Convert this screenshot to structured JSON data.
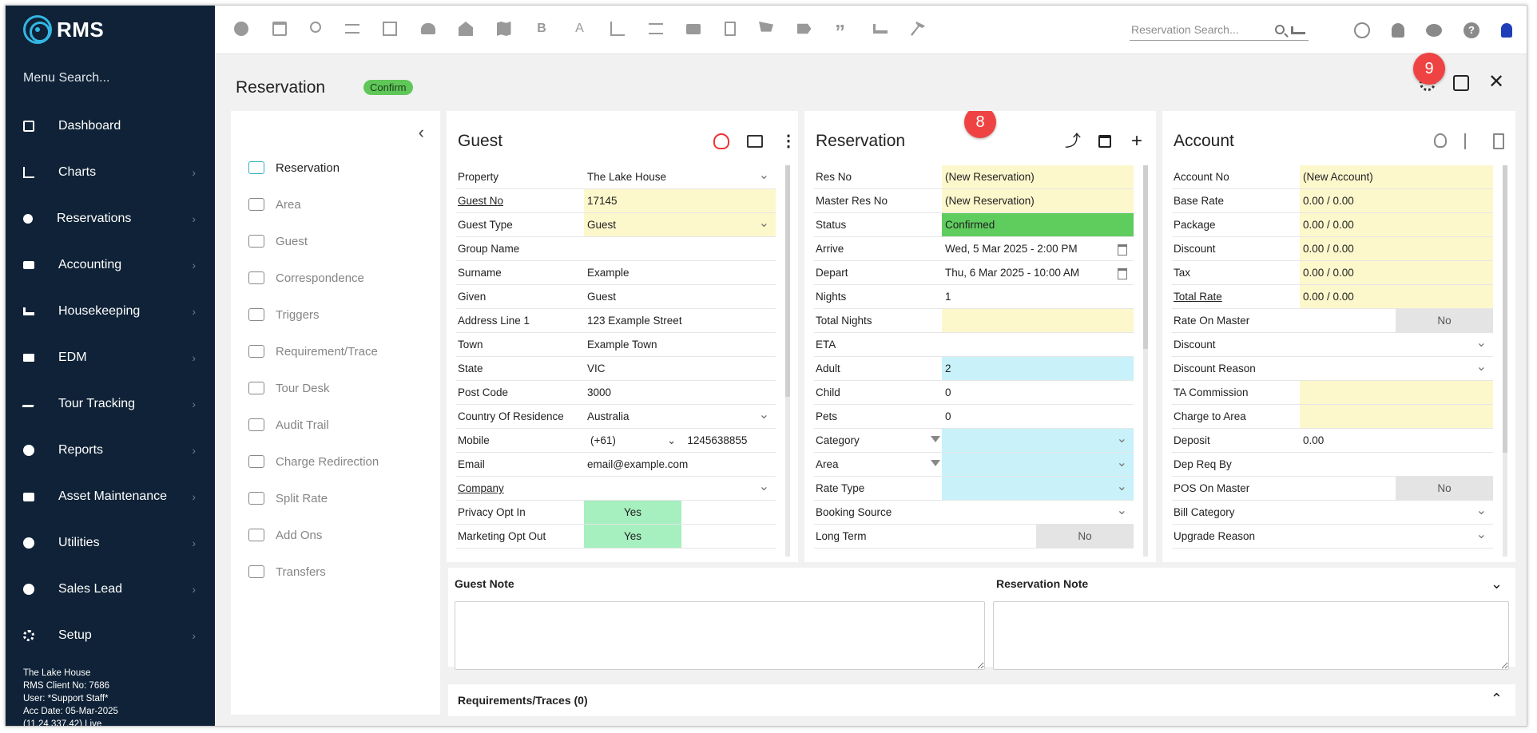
{
  "app": {
    "logo": "RMS"
  },
  "sidebar": {
    "menu_search": "Menu Search...",
    "items": [
      {
        "label": "Dashboard",
        "icon": "dashboard-icon",
        "chevron": false
      },
      {
        "label": "Charts",
        "icon": "charts-icon",
        "chevron": true
      },
      {
        "label": "Reservations",
        "icon": "reservations-icon",
        "chevron": true
      },
      {
        "label": "Accounting",
        "icon": "accounting-icon",
        "chevron": true
      },
      {
        "label": "Housekeeping",
        "icon": "housekeeping-icon",
        "chevron": true
      },
      {
        "label": "EDM",
        "icon": "edm-icon",
        "chevron": true
      },
      {
        "label": "Tour Tracking",
        "icon": "tour-tracking-icon",
        "chevron": true
      },
      {
        "label": "Reports",
        "icon": "reports-icon",
        "chevron": true
      },
      {
        "label": "Asset Maintenance",
        "icon": "asset-maintenance-icon",
        "chevron": true
      },
      {
        "label": "Utilities",
        "icon": "utilities-icon",
        "chevron": true
      },
      {
        "label": "Sales Lead",
        "icon": "sales-lead-icon",
        "chevron": true
      },
      {
        "label": "Setup",
        "icon": "setup-icon",
        "chevron": true
      }
    ],
    "footer": {
      "property": "The Lake House",
      "client": "RMS Client No: 7686",
      "user": "User: *Support Staff*",
      "acc_date": "Acc Date: 05-Mar-2025",
      "version": "(11.24.337.42) Live"
    }
  },
  "topbar": {
    "icons": [
      "add-icon",
      "calendar-icon",
      "search-icon",
      "sliders-icon",
      "grid-icon",
      "guests-icon",
      "map-pin-icon",
      "map-icon",
      "bold-b-icon",
      "letter-a-icon",
      "chart-line-icon",
      "checklist-icon",
      "id-card-icon",
      "document-icon",
      "cart-icon",
      "tag-icon",
      "quote-icon",
      "bed-icon",
      "hammer-icon"
    ],
    "search_placeholder": "Reservation Search...",
    "right_icons": [
      "globe-icon",
      "bell-icon",
      "chat-icon",
      "help-icon",
      "user-icon"
    ]
  },
  "page": {
    "title": "Reservation",
    "badge": "Confirm",
    "callout_8": "8",
    "callout_9": "9"
  },
  "left_nav": {
    "items": [
      {
        "label": "Reservation",
        "active": true
      },
      {
        "label": "Area"
      },
      {
        "label": "Guest"
      },
      {
        "label": "Correspondence"
      },
      {
        "label": "Triggers"
      },
      {
        "label": "Requirement/Trace"
      },
      {
        "label": "Tour Desk"
      },
      {
        "label": "Audit Trail"
      },
      {
        "label": "Charge Redirection"
      },
      {
        "label": "Split Rate"
      },
      {
        "label": "Add Ons"
      },
      {
        "label": "Transfers"
      }
    ]
  },
  "guest": {
    "title": "Guest",
    "rows": [
      {
        "label": "Property",
        "value": "The Lake House"
      },
      {
        "label": "Guest No",
        "value": "17145"
      },
      {
        "label": "Guest Type",
        "value": "Guest"
      },
      {
        "label": "Group Name",
        "value": ""
      },
      {
        "label": "Surname",
        "value": "Example"
      },
      {
        "label": "Given",
        "value": "Guest"
      },
      {
        "label": "Address Line 1",
        "value": "123 Example Street"
      },
      {
        "label": "Town",
        "value": "Example Town"
      },
      {
        "label": "State",
        "value": "VIC"
      },
      {
        "label": "Post Code",
        "value": "3000"
      },
      {
        "label": "Country Of Residence",
        "value": "Australia"
      },
      {
        "label": "Mobile",
        "value": "1245638855",
        "prefix": "(+61)"
      },
      {
        "label": "Email",
        "value": "email@example.com"
      },
      {
        "label": "Company",
        "value": ""
      },
      {
        "label": "Privacy Opt In",
        "value": "Yes"
      },
      {
        "label": "Marketing Opt Out",
        "value": "Yes"
      }
    ]
  },
  "reservation": {
    "title": "Reservation",
    "rows": [
      {
        "label": "Res No",
        "value": "(New Reservation)"
      },
      {
        "label": "Master Res No",
        "value": "(New Reservation)"
      },
      {
        "label": "Status",
        "value": "Confirmed"
      },
      {
        "label": "Arrive",
        "value": "Wed, 5 Mar 2025 - 2:00 PM"
      },
      {
        "label": "Depart",
        "value": "Thu, 6 Mar 2025 - 10:00 AM"
      },
      {
        "label": "Nights",
        "value": "1"
      },
      {
        "label": "Total Nights",
        "value": ""
      },
      {
        "label": "ETA",
        "value": ""
      },
      {
        "label": "Adult",
        "value": "2"
      },
      {
        "label": "Child",
        "value": "0"
      },
      {
        "label": "Pets",
        "value": "0"
      },
      {
        "label": "Category",
        "value": ""
      },
      {
        "label": "Area",
        "value": ""
      },
      {
        "label": "Rate Type",
        "value": ""
      },
      {
        "label": "Booking Source",
        "value": ""
      },
      {
        "label": "Long Term",
        "value": "No"
      }
    ]
  },
  "account": {
    "title": "Account",
    "rows": [
      {
        "label": "Account No",
        "value": "(New Account)"
      },
      {
        "label": "Base Rate",
        "value": "0.00 / 0.00"
      },
      {
        "label": "Package",
        "value": "0.00 / 0.00"
      },
      {
        "label": "Discount",
        "value": "0.00 / 0.00"
      },
      {
        "label": "Tax",
        "value": "0.00 / 0.00"
      },
      {
        "label": "Total Rate",
        "value": "0.00 / 0.00"
      },
      {
        "label": "Rate On Master",
        "value": "No"
      },
      {
        "label": "Discount",
        "value": ""
      },
      {
        "label": "Discount Reason",
        "value": ""
      },
      {
        "label": "TA Commission",
        "value": ""
      },
      {
        "label": "Charge to Area",
        "value": ""
      },
      {
        "label": "Deposit",
        "value": "0.00"
      },
      {
        "label": "Dep Req By",
        "value": ""
      },
      {
        "label": "POS On Master",
        "value": "No"
      },
      {
        "label": "Bill Category",
        "value": ""
      },
      {
        "label": "Upgrade Reason",
        "value": ""
      }
    ]
  },
  "notes": {
    "guest_note": "Guest Note",
    "reservation_note": "Reservation Note"
  },
  "requirements": {
    "label": "Requirements/Traces (0)"
  },
  "colors": {
    "sidebar": "#0f2237",
    "accent": "#34b6e4",
    "confirm": "#5ec758",
    "callout": "#ef4343"
  }
}
